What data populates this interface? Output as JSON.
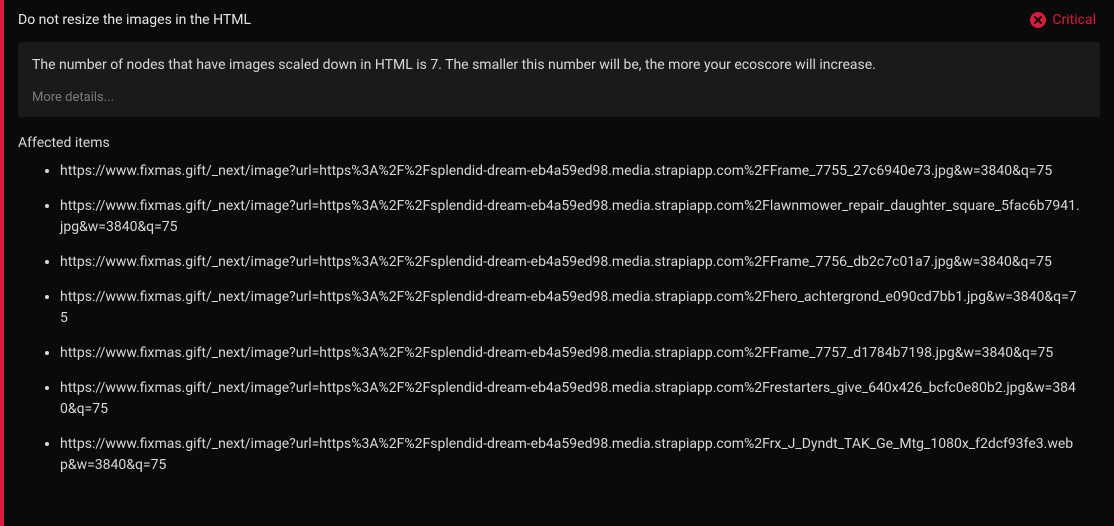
{
  "header": {
    "title": "Do not resize the images in the HTML",
    "severity_label": "Critical"
  },
  "description": {
    "text": "The number of nodes that have images scaled down in HTML is 7. The smaller this number will be, the more your ecoscore will increase.",
    "more_details": "More details..."
  },
  "affected": {
    "label": "Affected items",
    "items": [
      "https://www.fixmas.gift/_next/image?url=https%3A%2F%2Fsplendid-dream-eb4a59ed98.media.strapiapp.com%2FFrame_7755_27c6940e73.jpg&w=3840&q=75",
      "https://www.fixmas.gift/_next/image?url=https%3A%2F%2Fsplendid-dream-eb4a59ed98.media.strapiapp.com%2Flawnmower_repair_daughter_square_5fac6b7941.jpg&w=3840&q=75",
      "https://www.fixmas.gift/_next/image?url=https%3A%2F%2Fsplendid-dream-eb4a59ed98.media.strapiapp.com%2FFrame_7756_db2c7c01a7.jpg&w=3840&q=75",
      "https://www.fixmas.gift/_next/image?url=https%3A%2F%2Fsplendid-dream-eb4a59ed98.media.strapiapp.com%2Fhero_achtergrond_e090cd7bb1.jpg&w=3840&q=75",
      "https://www.fixmas.gift/_next/image?url=https%3A%2F%2Fsplendid-dream-eb4a59ed98.media.strapiapp.com%2FFrame_7757_d1784b7198.jpg&w=3840&q=75",
      "https://www.fixmas.gift/_next/image?url=https%3A%2F%2Fsplendid-dream-eb4a59ed98.media.strapiapp.com%2Frestarters_give_640x426_bcfc0e80b2.jpg&w=3840&q=75",
      "https://www.fixmas.gift/_next/image?url=https%3A%2F%2Fsplendid-dream-eb4a59ed98.media.strapiapp.com%2Frx_J_Dyndt_TAK_Ge_Mtg_1080x_f2dcf93fe3.webp&w=3840&q=75"
    ]
  }
}
